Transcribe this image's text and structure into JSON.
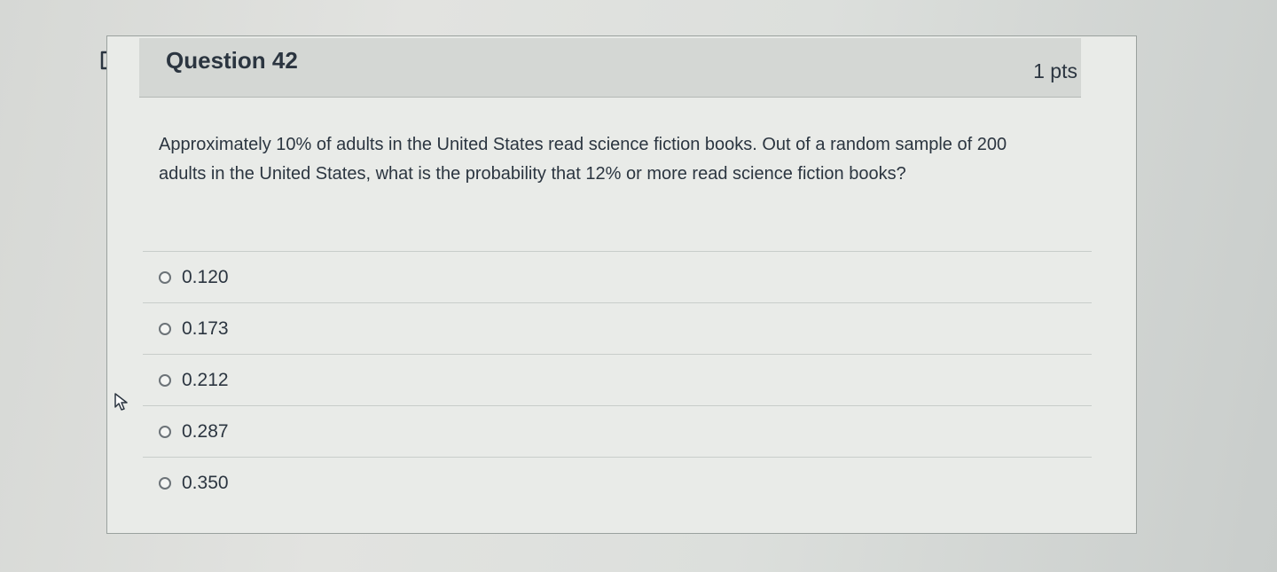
{
  "question": {
    "title": "Question 42",
    "points": "1 pts",
    "text": "Approximately 10% of adults in the United States read science fiction books. Out of a random sample of 200 adults in the United States, what is the probability that 12% or more read science fiction books?"
  },
  "answers": [
    {
      "label": "0.120",
      "selected": false
    },
    {
      "label": "0.173",
      "selected": false
    },
    {
      "label": "0.212",
      "selected": false
    },
    {
      "label": "0.287",
      "selected": false
    },
    {
      "label": "0.350",
      "selected": false
    }
  ],
  "icons": {
    "flag": "flag-icon",
    "cursor": "pointer-cursor-icon",
    "radio": "radio-button-icon"
  },
  "colors": {
    "text": "#2b3540",
    "header_bg": "#d4d7d4",
    "border": "#9aa19e"
  }
}
